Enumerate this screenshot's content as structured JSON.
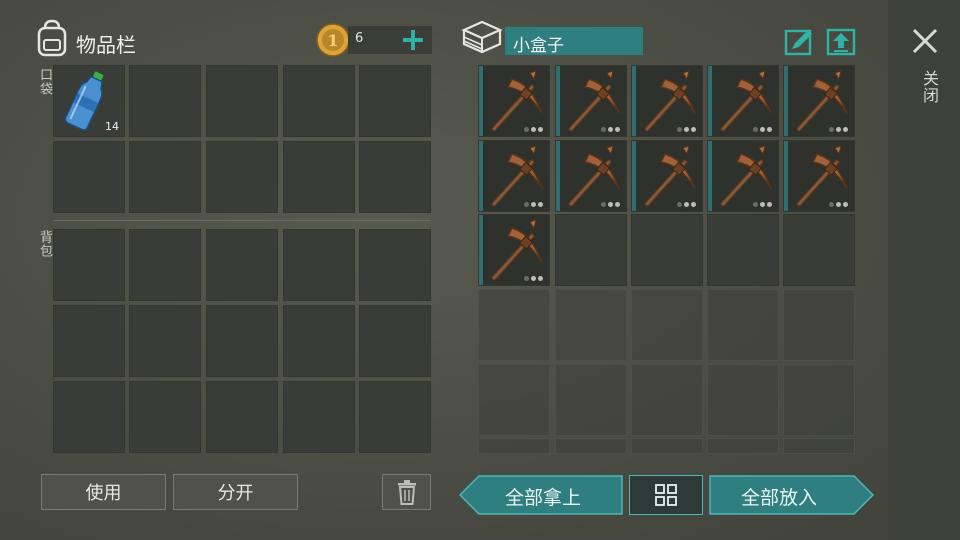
{
  "inventory": {
    "title": "物品栏",
    "coin_count": "6",
    "pocket_label": "口袋",
    "backpack_label": "背包",
    "pocket_items": [
      {
        "name": "water-bottle",
        "qty": "14"
      }
    ]
  },
  "container": {
    "title": "小盒子",
    "items": [
      "pickaxe",
      "pickaxe",
      "pickaxe",
      "pickaxe",
      "pickaxe",
      "pickaxe",
      "pickaxe",
      "pickaxe",
      "pickaxe",
      "pickaxe",
      "pickaxe"
    ]
  },
  "buttons": {
    "use": "使用",
    "split": "分开",
    "take_all": "全部拿上",
    "put_all": "全部放入",
    "close": "关闭"
  },
  "colors": {
    "accent_teal": "#2f7f80",
    "coin_gold": "#d9a43a",
    "plus_teal": "#2fb3a6"
  },
  "icons": {
    "backpack": "backpack-icon",
    "coin": "coin-icon",
    "plus": "plus-icon",
    "box": "box-icon",
    "rename": "edit-icon",
    "upload": "upload-icon",
    "trash": "trash-icon",
    "sort": "grid-sort-icon",
    "close": "close-icon"
  }
}
